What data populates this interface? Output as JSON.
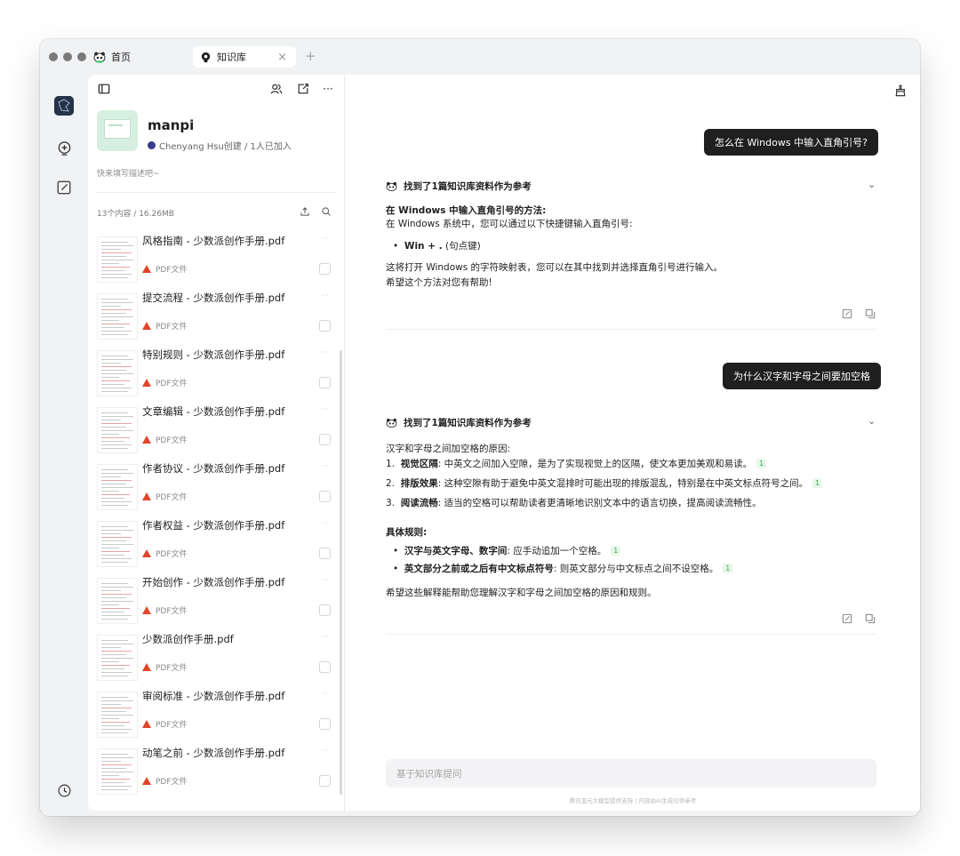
{
  "tabs": {
    "home": "首页",
    "active": "知识库",
    "close": "×",
    "new": "+"
  },
  "kb": {
    "name": "manpi",
    "meta": "Chenyang Hsu创建 / 1人已加入",
    "description": "快来填写描述吧~",
    "count": "13个内容 / 16.26MB"
  },
  "docs": [
    {
      "name": "风格指南 - 少数派创作手册.pdf",
      "type": "PDF文件"
    },
    {
      "name": "提交流程 - 少数派创作手册.pdf",
      "type": "PDF文件"
    },
    {
      "name": "特别规则 - 少数派创作手册.pdf",
      "type": "PDF文件"
    },
    {
      "name": "文章编辑 - 少数派创作手册.pdf",
      "type": "PDF文件"
    },
    {
      "name": "作者协议 - 少数派创作手册.pdf",
      "type": "PDF文件"
    },
    {
      "name": "作者权益 - 少数派创作手册.pdf",
      "type": "PDF文件"
    },
    {
      "name": "开始创作 - 少数派创作手册.pdf",
      "type": "PDF文件"
    },
    {
      "name": "少数派创作手册.pdf",
      "type": "PDF文件"
    },
    {
      "name": "审阅标准 - 少数派创作手册.pdf",
      "type": "PDF文件"
    },
    {
      "name": "动笔之前 - 少数派创作手册.pdf",
      "type": "PDF文件"
    }
  ],
  "chat": {
    "q1": "怎么在 Windows 中输入直角引号?",
    "ref1": "找到了1篇知识库资料作为参考",
    "a1": {
      "title": "在 Windows 中输入直角引号的方法:",
      "line1": "在 Windows 系统中，您可以通过以下快捷键输入直角引号:",
      "bullet": "Win + .",
      "bullet_suffix": " (句点键)",
      "line2": "这将打开 Windows 的字符映射表，您可以在其中找到并选择直角引号进行输入。",
      "line3": "希望这个方法对您有帮助!"
    },
    "q2": "为什么汉字和字母之间要加空格",
    "ref2": "找到了1篇知识库资料作为参考",
    "a2": {
      "title": "汉字和字母之间加空格的原因:",
      "items": [
        {
          "num": "1.",
          "label": "视觉区隔",
          "text": ": 中英文之间加入空隙，是为了实现视觉上的区隔，使文本更加美观和易读。",
          "badge": "1"
        },
        {
          "num": "2.",
          "label": "排版效果",
          "text": ": 这种空隙有助于避免中英文混排时可能出现的排版混乱，特别是在中英文标点符号之间。",
          "badge": "1"
        },
        {
          "num": "3.",
          "label": "阅读流畅",
          "text": ": 适当的空格可以帮助读者更清晰地识别文本中的语言切换，提高阅读流畅性。",
          "badge": ""
        }
      ],
      "rules_title": "具体规则:",
      "rules": [
        {
          "label": "汉字与英文字母、数字间",
          "text": ": 应手动追加一个空格。",
          "badge": "1"
        },
        {
          "label": "英文部分之前或之后有中文标点符号",
          "text": ": 则英文部分与中文标点之间不设空格。",
          "badge": "1"
        }
      ],
      "closing": "希望这些解释能帮助您理解汉字和字母之间加空格的原因和规则。"
    },
    "placeholder": "基于知识库提问",
    "footer": "腾讯混元大模型提供支持 | 内容由AI生成仅供参考"
  },
  "colors": {
    "accent": "#1f1f1f",
    "pdf": "#e0462a",
    "badge_bg": "#e6f6ea",
    "badge_fg": "#2aa84a"
  }
}
